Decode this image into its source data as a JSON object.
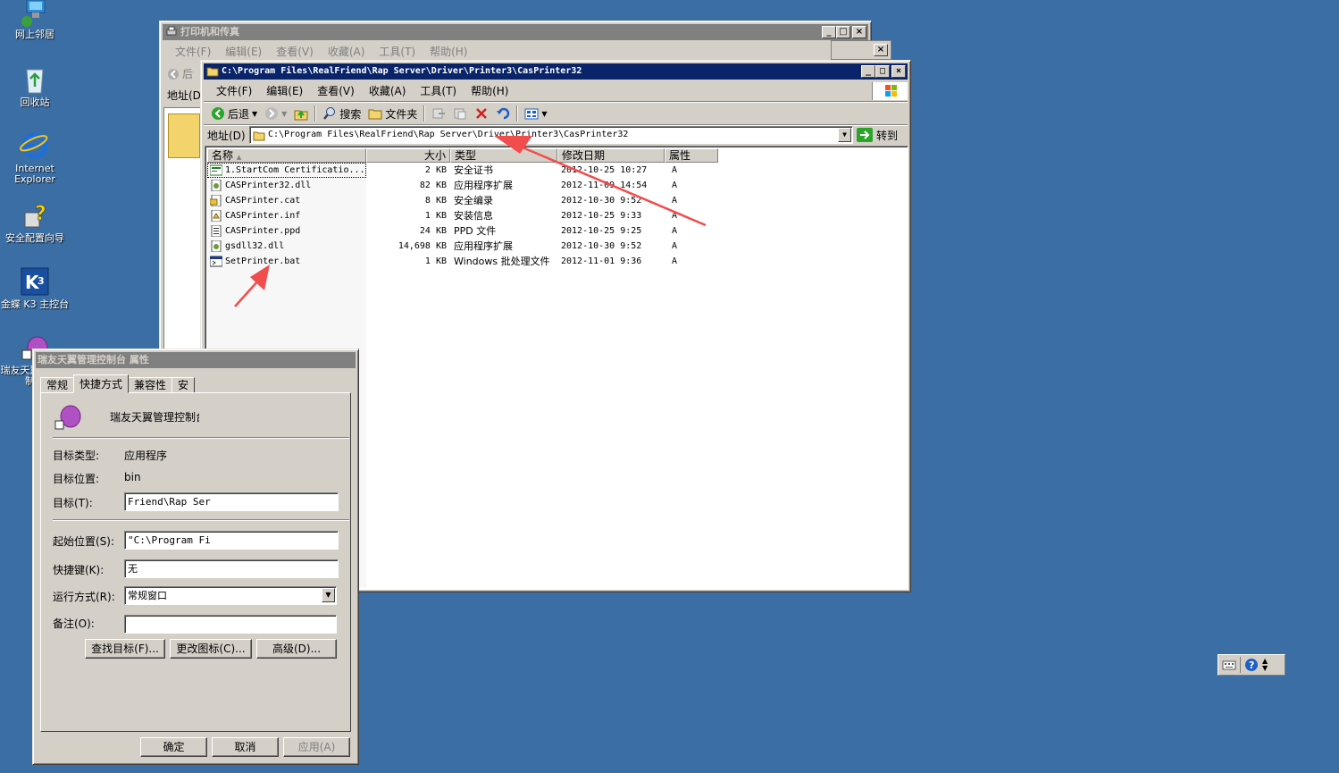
{
  "desktop": {
    "icons": [
      {
        "label": "网上邻居"
      },
      {
        "label": "回收站"
      },
      {
        "label": "Internet Explorer"
      },
      {
        "label": "安全配置向导"
      },
      {
        "label": "金蝶 K3 主控台"
      },
      {
        "label": "瑞友天翼管理控制台"
      }
    ]
  },
  "printers_window": {
    "title": "打印机和传真",
    "menu": [
      "文件(F)",
      "编辑(E)",
      "查看(V)",
      "收藏(A)",
      "工具(T)",
      "帮助(H)"
    ],
    "back_label": "后",
    "address_label": "地址(D)"
  },
  "explorer": {
    "title": "C:\\Program Files\\RealFriend\\Rap Server\\Driver\\Printer3\\CasPrinter32",
    "menu": [
      "文件(F)",
      "编辑(E)",
      "查看(V)",
      "收藏(A)",
      "工具(T)",
      "帮助(H)"
    ],
    "toolbar": {
      "back": "后退",
      "search": "搜索",
      "folders": "文件夹"
    },
    "address_label": "地址(D)",
    "address_value": "C:\\Program Files\\RealFriend\\Rap Server\\Driver\\Printer3\\CasPrinter32",
    "go_label": "转到",
    "columns": [
      "名称",
      "大小",
      "类型",
      "修改日期",
      "属性"
    ],
    "files": [
      {
        "name": "1.StartCom Certificatio...",
        "size": "2 KB",
        "type": "安全证书",
        "date": "2012-10-25 10:27",
        "attr": "A",
        "icon": "certificate-icon"
      },
      {
        "name": "CASPrinter32.dll",
        "size": "82 KB",
        "type": "应用程序扩展",
        "date": "2012-11-09 14:54",
        "attr": "A",
        "icon": "dll-icon"
      },
      {
        "name": "CASPrinter.cat",
        "size": "8 KB",
        "type": "安全编录",
        "date": "2012-10-30 9:52",
        "attr": "A",
        "icon": "catalog-icon"
      },
      {
        "name": "CASPrinter.inf",
        "size": "1 KB",
        "type": "安装信息",
        "date": "2012-10-25 9:33",
        "attr": "A",
        "icon": "inf-icon"
      },
      {
        "name": "CASPrinter.ppd",
        "size": "24 KB",
        "type": "PPD 文件",
        "date": "2012-10-25 9:25",
        "attr": "A",
        "icon": "ppd-icon"
      },
      {
        "name": "gsdll32.dll",
        "size": "14,698 KB",
        "type": "应用程序扩展",
        "date": "2012-10-30 9:52",
        "attr": "A",
        "icon": "dll-icon"
      },
      {
        "name": "SetPrinter.bat",
        "size": "1 KB",
        "type": "Windows 批处理文件",
        "date": "2012-11-01 9:36",
        "attr": "A",
        "icon": "bat-icon"
      }
    ]
  },
  "properties": {
    "title": "瑞友天翼管理控制台 属性",
    "tabs": [
      "常规",
      "快捷方式",
      "兼容性",
      "安"
    ],
    "app_name": "瑞友天翼管理控制台",
    "target_type_label": "目标类型:",
    "target_type_value": "应用程序",
    "target_location_label": "目标位置:",
    "target_location_value": "bin",
    "target_label": "目标(T):",
    "target_value": "Friend\\Rap Ser",
    "start_in_label": "起始位置(S):",
    "start_in_value": "\"C:\\Program Fi",
    "hotkey_label": "快捷键(K):",
    "hotkey_value": "无",
    "run_label": "运行方式(R):",
    "run_value": "常规窗口",
    "comment_label": "备注(O):",
    "comment_value": "",
    "find_target": "查找目标(F)...",
    "change_icon": "更改图标(C)...",
    "advanced": "高级(D)...",
    "ok": "确定",
    "cancel": "取消",
    "apply": "应用(A)"
  },
  "colors": {
    "desktop": "#3a6ea5",
    "titlebar_active": "#0a246a",
    "arrow": "#f24d4d"
  }
}
